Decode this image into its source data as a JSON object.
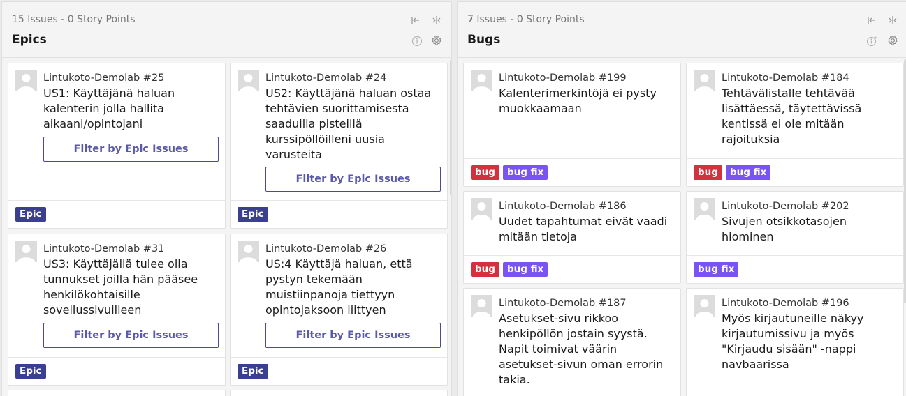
{
  "columns": {
    "epics": {
      "count": "15 Issues",
      "separator": " - ",
      "points": "0 Story Points",
      "title": "Epics",
      "cards": [
        {
          "key": "Lintukoto-Demolab #25",
          "title": "US1: Käyttäjänä haluan kalenterin jolla hallita aikaani/opintojani",
          "button": "Filter by Epic Issues",
          "tag": "Epic"
        },
        {
          "key": "Lintukoto-Demolab #24",
          "title": "US2: Käyttäjänä haluan ostaa tehtävien suorittamisesta saaduilla pisteillä kurssipöllöilleni uusia varusteita",
          "button": "Filter by Epic Issues",
          "tag": "Epic"
        },
        {
          "key": "Lintukoto-Demolab #31",
          "title": "US3: Käyttäjällä tulee olla tunnukset joilla hän pääsee henkilökohtaisille sovellussivuilleen",
          "button": "Filter by Epic Issues",
          "tag": "Epic"
        },
        {
          "key": "Lintukoto-Demolab #26",
          "title": "US:4 Käyttäjä haluan, että pystyn tekemään muistiinpanoja tiettyyn opintojaksoon liittyen",
          "button": "Filter by Epic Issues",
          "tag": "Epic"
        }
      ]
    },
    "bugs": {
      "count": "7 Issues",
      "separator": " - ",
      "points": "0 Story Points",
      "title": "Bugs",
      "cards": [
        {
          "key": "Lintukoto-Demolab #199",
          "title": "Kalenterimerkintöjä ei pysty muokkaamaan",
          "tags": [
            "bug",
            "bug fix"
          ]
        },
        {
          "key": "Lintukoto-Demolab #184",
          "title": "Tehtävälistalle tehtävää lisättäessä, täytettävissä kentissä ei ole mitään rajoituksia",
          "tags": [
            "bug",
            "bug fix"
          ]
        },
        {
          "key": "Lintukoto-Demolab #186",
          "title": "Uudet tapahtumat eivät vaadi mitään tietoja",
          "tags": [
            "bug",
            "bug fix"
          ]
        },
        {
          "key": "Lintukoto-Demolab #202",
          "title": "Sivujen otsikkotasojen hiominen",
          "tags": [
            "bug fix"
          ]
        },
        {
          "key": "Lintukoto-Demolab #187",
          "title": "Asetukset-sivu rikkoo henkipöllön jostain syystä. Napit toimivat väärin asetukset-sivun oman errorin takia."
        },
        {
          "key": "Lintukoto-Demolab #196",
          "title": "Myös kirjautuneille näkyy kirjautumissivu ja myös \"Kirjaudu sisään\" -nappi navbaarissa"
        }
      ]
    }
  },
  "colors": {
    "epic_tag": "#3b3f8f",
    "bug_tag": "#d3313e",
    "bugfix_tag": "#7a54f2",
    "filter_button_text": "#5a5aa8"
  },
  "icons": [
    "collapse-left-icon",
    "collapse-column-icon",
    "info-icon",
    "settings-gear-icon",
    "add-info-icon",
    "user-avatar-icon"
  ]
}
